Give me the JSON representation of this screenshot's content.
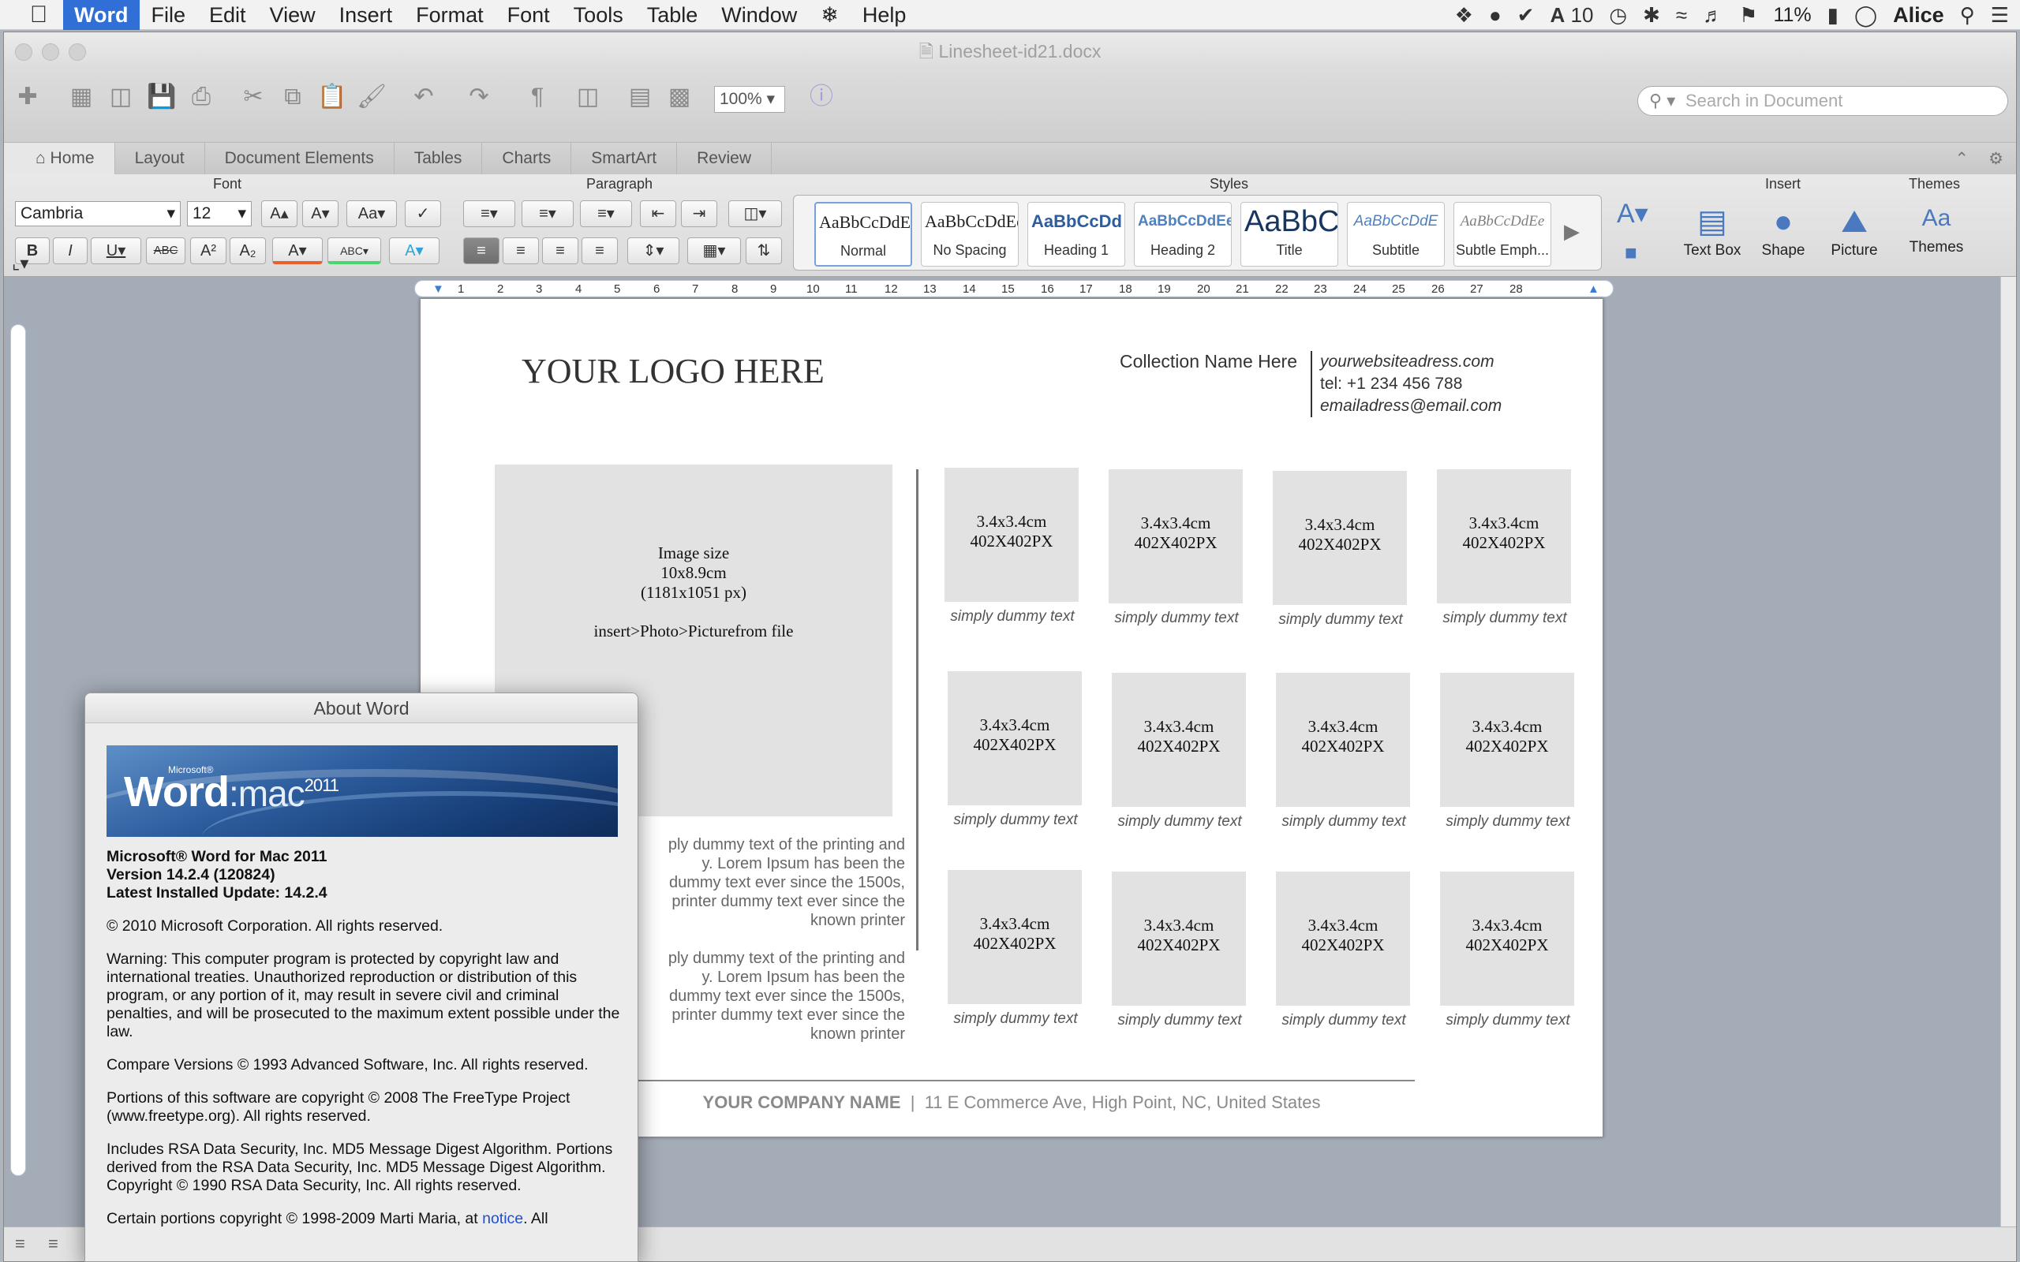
{
  "menubar": {
    "app_name": "Word",
    "items": [
      "File",
      "Edit",
      "View",
      "Insert",
      "Format",
      "Font",
      "Tools",
      "Table",
      "Window",
      "Help"
    ],
    "font_count": "10",
    "battery": "11%",
    "user": "Alice"
  },
  "window": {
    "title": "Linesheet-id21.docx",
    "zoom": "100%",
    "search_placeholder": "Search in Document"
  },
  "ribbon": {
    "tabs": [
      "Home",
      "Layout",
      "Document Elements",
      "Tables",
      "Charts",
      "SmartArt",
      "Review"
    ],
    "group_font": "Font",
    "group_paragraph": "Paragraph",
    "group_styles": "Styles",
    "group_insert": "Insert",
    "group_themes": "Themes",
    "font_name": "Cambria",
    "font_size": "12",
    "styles": [
      {
        "sample": "AaBbCcDdEe",
        "label": "Normal"
      },
      {
        "sample": "AaBbCcDdEe",
        "label": "No Spacing"
      },
      {
        "sample": "AaBbCcDd",
        "label": "Heading 1"
      },
      {
        "sample": "AaBbCcDdEe",
        "label": "Heading 2"
      },
      {
        "sample": "AaBbC",
        "label": "Title"
      },
      {
        "sample": "AaBbCcDdE",
        "label": "Subtitle"
      },
      {
        "sample": "AaBbCcDdEe",
        "label": "Subtle Emph..."
      }
    ],
    "insert_items": [
      "Text Box",
      "Shape",
      "Picture"
    ],
    "themes_label": "Themes",
    "themes_icon_text": "Aa"
  },
  "ruler_numbers": [
    "1",
    "2",
    "3",
    "4",
    "5",
    "6",
    "7",
    "8",
    "9",
    "10",
    "11",
    "12",
    "13",
    "14",
    "15",
    "16",
    "17",
    "18",
    "19",
    "20",
    "21",
    "22",
    "23",
    "24",
    "25",
    "26",
    "27",
    "28"
  ],
  "document": {
    "logo": "YOUR LOGO HERE",
    "collection": "Collection Name Here",
    "website": "yourwebsiteadress.com",
    "tel": "tel: +1 234 456 788",
    "email": "emailadress@email.com",
    "hero": {
      "line1": "Image size",
      "line2": "10x8.9cm",
      "line3": "(1181x1051 px)",
      "line4": "insert>Photo>Picturefrom file"
    },
    "para1": [
      "ply dummy text of the printing and",
      "y. Lorem Ipsum has been the",
      "dummy text ever since the 1500s,",
      "printer dummy text ever since the",
      "known printer"
    ],
    "para2": [
      "ply dummy text of the printing and",
      "y. Lorem Ipsum has been the",
      "dummy text ever since the 1500s,",
      "printer dummy text ever since the",
      "known printer"
    ],
    "thumb_line1": "3.4x3.4cm",
    "thumb_line2": "402X402PX",
    "thumb_caption": "simply dummy text",
    "footer_company": "YOUR COMPANY NAME",
    "footer_sep": "|",
    "footer_address": "11 E Commerce Ave, High Point, NC, United States"
  },
  "about": {
    "title": "About Word",
    "banner_ms": "Microsoft®",
    "banner_word": "Word",
    "banner_mac": ":mac",
    "banner_year": "2011",
    "product": "Microsoft® Word for Mac 2011",
    "version": "Version 14.2.4 (120824)",
    "update": "Latest Installed Update: 14.2.4",
    "copyright": "© 2010 Microsoft Corporation. All rights reserved.",
    "warning": "Warning: This computer program is protected by copyright law and international treaties.  Unauthorized reproduction or distribution of this program, or any portion of it, may result in severe civil and criminal penalties, and will be prosecuted to the maximum extent possible under the law.",
    "compare": "Compare Versions © 1993 Advanced Software, Inc.  All rights reserved.",
    "freetype": "Portions of this software are copyright © 2008 The FreeType Project (www.freetype.org).  All rights reserved.",
    "rsa": "Includes RSA Data Security, Inc. MD5 Message Digest Algorithm. Portions derived from the RSA Data Security, Inc. MD5 Message Digest Algorithm.  Copyright © 1990 RSA Data Security, Inc. All rights reserved.",
    "certain": "Certain portions copyright © 1998-2009  Marti Maria, at",
    "notice_link": "notice",
    "certain_end": ". All"
  }
}
